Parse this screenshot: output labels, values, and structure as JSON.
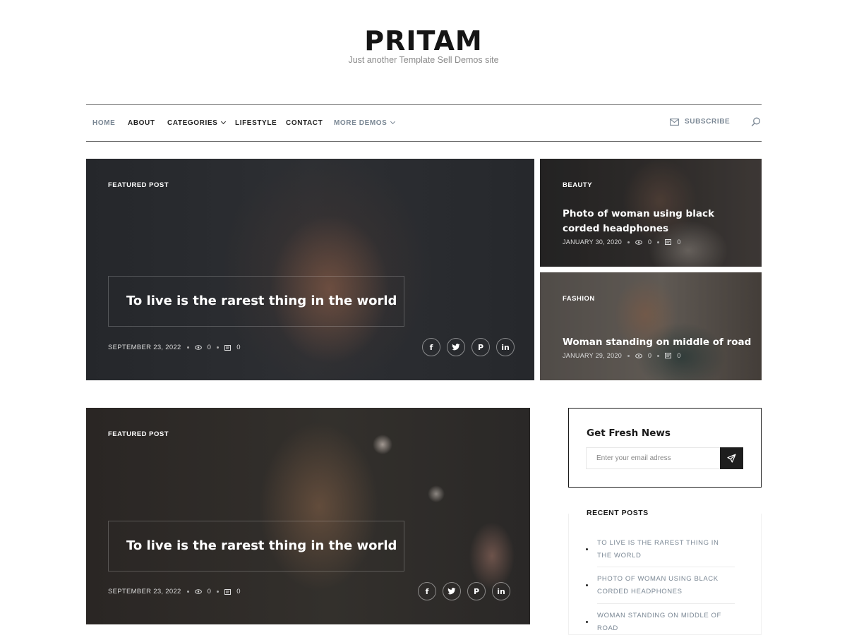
{
  "site": {
    "title": "PRITAM",
    "tagline": "Just another Template Sell Demos site"
  },
  "nav": {
    "items": [
      "HOME",
      "ABOUT",
      "CATEGORIES",
      "LIFESTYLE",
      "CONTACT",
      "MORE DEMOS"
    ],
    "subscribe": "SUBSCRIBE"
  },
  "featured": {
    "category": "FEATURED POST",
    "title": "To live is the rarest thing in the world",
    "date": "SEPTEMBER 23, 2022",
    "views": "0",
    "comments": "0"
  },
  "side_posts": [
    {
      "category": "BEAUTY",
      "title": "Photo of woman using black corded headphones",
      "date": "JANUARY 30, 2020",
      "views": "0",
      "comments": "0"
    },
    {
      "category": "FASHION",
      "title": "Woman standing on middle of road",
      "date": "JANUARY 29, 2020",
      "views": "0",
      "comments": "0"
    }
  ],
  "featured2": {
    "category": "FEATURED POST",
    "title": "To live is the rarest thing in the world",
    "date": "SEPTEMBER 23, 2022",
    "views": "0",
    "comments": "0"
  },
  "social": {
    "facebook": "f",
    "pinterest": "P",
    "linkedin": "in"
  },
  "newsletter": {
    "title": "Get Fresh News",
    "placeholder": "Enter your email adress"
  },
  "recent": {
    "title": "RECENT POSTS",
    "items": [
      "TO LIVE IS THE RAREST THING IN THE WORLD",
      "PHOTO OF WOMAN USING BLACK CORDED HEADPHONES",
      "WOMAN STANDING ON MIDDLE OF ROAD"
    ]
  },
  "colors": {
    "accent": "#7a8794",
    "dark": "#1d1d1d"
  }
}
